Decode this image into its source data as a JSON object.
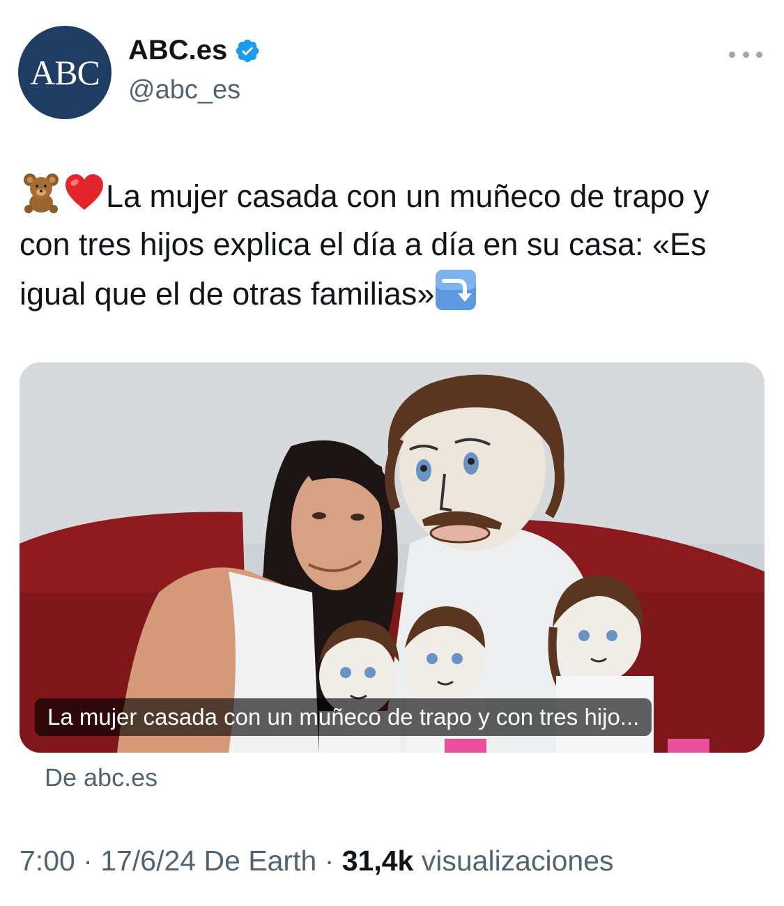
{
  "author": {
    "avatar_text": "ABC",
    "display_name": "ABC.es",
    "handle": "@abc_es",
    "verified": true,
    "avatar_color": "#1f3d63",
    "verified_color": "#1d9bf0"
  },
  "tweet": {
    "emojis": [
      "teddy-bear",
      "red-heart"
    ],
    "text": "La mujer casada con un muñeco de trapo y con tres hijos explica el día a día en su casa: «Es igual que el de otras familias»",
    "trailing_emoji": "down-right-arrow"
  },
  "card": {
    "caption": "La mujer casada con un muñeco de trapo y con tres hijo...",
    "source": "De abc.es"
  },
  "meta": {
    "time": "7:00",
    "date": "17/6/24",
    "via": "De Earth",
    "views_count": "31,4k",
    "views_label": "visualizaciones"
  }
}
